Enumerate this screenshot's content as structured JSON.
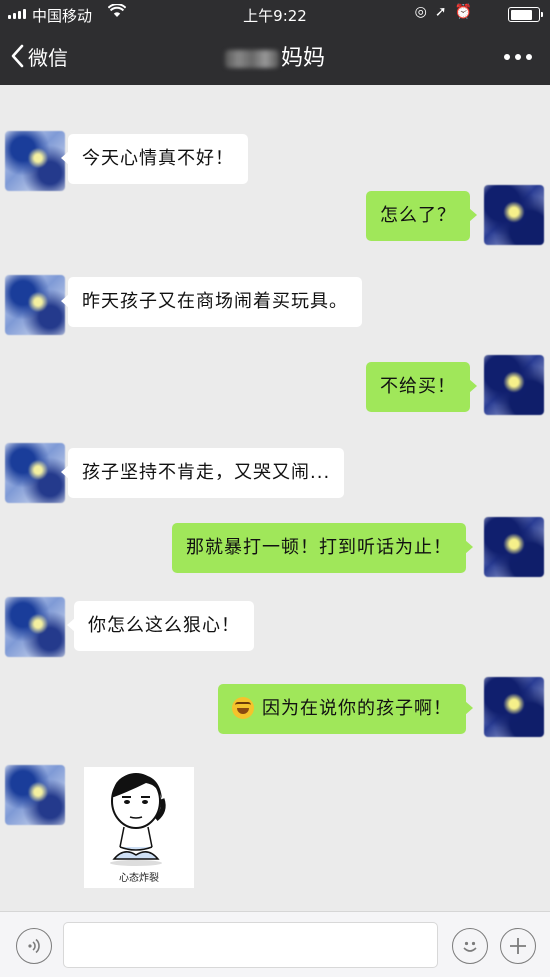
{
  "status_bar": {
    "carrier": "中国移动",
    "time": "上午9:22"
  },
  "nav": {
    "back_label": "微信",
    "title": "妈妈"
  },
  "messages": [
    {
      "side": "left",
      "text": "今天心情真不好！"
    },
    {
      "side": "right",
      "text": "怎么了？"
    },
    {
      "side": "left",
      "text": "昨天孩子又在商场闹着买玩具。"
    },
    {
      "side": "right",
      "text": "不给买！"
    },
    {
      "side": "left",
      "text": "孩子坚持不肯走，又哭又闹..."
    },
    {
      "side": "right",
      "text": "那就暴打一顿！打到听话为止！"
    },
    {
      "side": "left",
      "text": "你怎么这么狠心！"
    },
    {
      "side": "right",
      "emoji": "laughing-crying-emoji",
      "text": "因为在说你的孩子啊！"
    }
  ],
  "sticker": {
    "caption": "心态炸裂"
  },
  "input_bar": {
    "voice_icon": "voice-icon",
    "emoji_icon": "smiley-icon",
    "plus_icon": "plus-icon"
  },
  "colors": {
    "nav_bg": "#2e2e30",
    "chat_bg": "#ebebeb",
    "bubble_self": "#a0e75a",
    "bubble_other": "#ffffff"
  }
}
